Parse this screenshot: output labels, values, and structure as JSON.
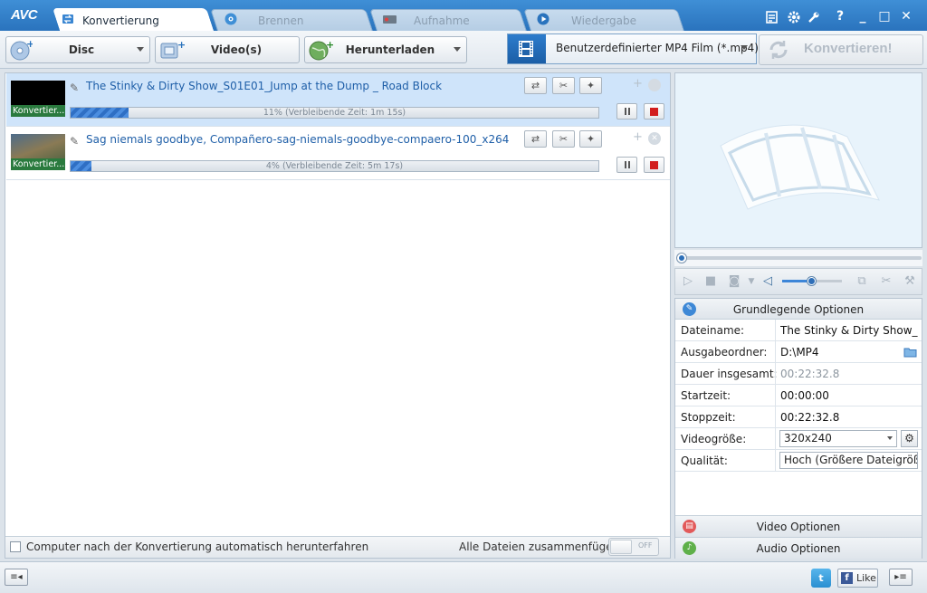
{
  "app": {
    "logo": "AVC"
  },
  "tabs": [
    {
      "label": "Konvertierung",
      "active": true
    },
    {
      "label": "Brennen"
    },
    {
      "label": "Aufnahme"
    },
    {
      "label": "Wiedergabe"
    }
  ],
  "toolbar": {
    "disc_label": "Disc",
    "video_label": "Video(s)",
    "download_label": "Herunterladen",
    "format_label": "Benutzerdefinierter MP4 Film (*.mp4)",
    "convert_label": "Konvertieren!"
  },
  "items": [
    {
      "title": "The Stinky & Dirty Show_S01E01_Jump at the Dump _ Road Block",
      "thumb_label": "Konvertier...",
      "progress": 11,
      "progress_text": "11% (Verbleibende Zeit: 1m 15s)"
    },
    {
      "title": "Sag niemals goodbye, Compañero-sag-niemals-goodbye-compaero-100_x264",
      "thumb_label": "Konvertier...",
      "progress": 4,
      "progress_text": "4% (Verbleibende Zeit: 5m 17s)"
    }
  ],
  "list_footer": {
    "shutdown_label": "Computer nach der Konvertierung automatisch herunterfahren",
    "merge_label": "Alle Dateien zusammenfügen",
    "toggle_state": "OFF"
  },
  "options": {
    "header": "Grundlegende Optionen",
    "rows": [
      {
        "key": "Dateiname:",
        "value": "The Stinky & Dirty Show_S..."
      },
      {
        "key": "Ausgabeordner:",
        "value": "D:\\MP4"
      },
      {
        "key": "Dauer insgesamt:",
        "value": "00:22:32.8"
      },
      {
        "key": "Startzeit:",
        "value": "00:00:00"
      },
      {
        "key": "Stoppzeit:",
        "value": "00:22:32.8"
      },
      {
        "key": "Videogröße:",
        "value": "320x240"
      },
      {
        "key": "Qualität:",
        "value": "Hoch (Größere Dateigröße)"
      }
    ],
    "video_section": "Video Optionen",
    "audio_section": "Audio Optionen"
  },
  "status": {
    "like_label": "Like"
  },
  "colors": {
    "accent": "#2a73bd",
    "progress": "#3a7fd4",
    "stop": "#d21e1e",
    "selected_row": "#cfe4fa"
  },
  "icons": {
    "disc": "disc-icon",
    "video": "film-icon",
    "download": "globe-icon",
    "format": "film-strip-icon",
    "convert": "refresh-icon"
  }
}
